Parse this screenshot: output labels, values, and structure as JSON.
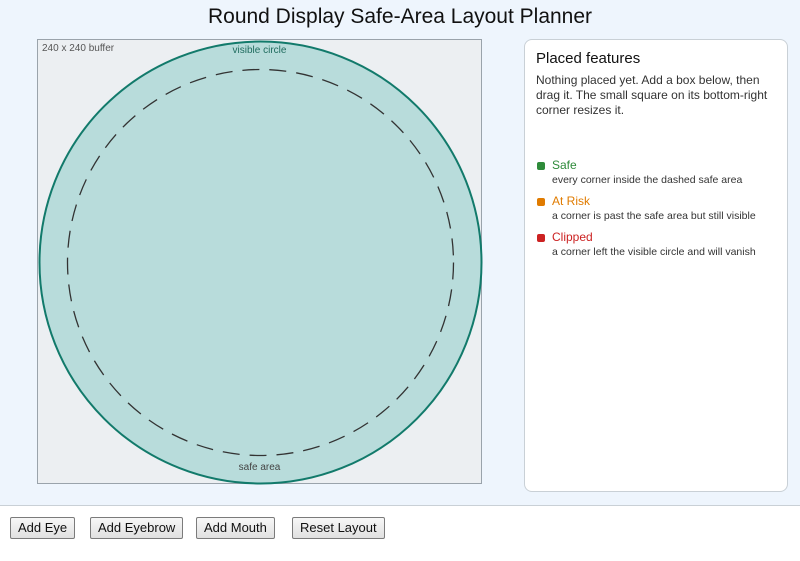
{
  "title": "Round Display Safe-Area Layout Planner",
  "canvas": {
    "buffer_label": "240 x 240 buffer",
    "visible_circle_label": "visible circle",
    "safe_area_label": "safe area"
  },
  "panel": {
    "heading": "Placed features",
    "hint": "Nothing placed yet. Add a box below, then drag it. The small square on its bottom-right corner resizes it.",
    "legend": [
      {
        "name": "Safe",
        "desc": "every corner inside the dashed safe area",
        "color": "#2e8b3a"
      },
      {
        "name": "At Risk",
        "desc": "a corner is past the safe area but still visible",
        "color": "#e07b00"
      },
      {
        "name": "Clipped",
        "desc": "a corner left the visible circle and will vanish",
        "color": "#cc2222"
      }
    ]
  },
  "buttons": {
    "add_eye": "Add Eye",
    "add_eyebrow": "Add Eyebrow",
    "add_mouth": "Add Mouth",
    "reset_layout": "Reset Layout"
  },
  "colors": {
    "circle_fill": "#b8dcdb",
    "circle_stroke": "#127a6b",
    "safe_dash": "#333333"
  }
}
